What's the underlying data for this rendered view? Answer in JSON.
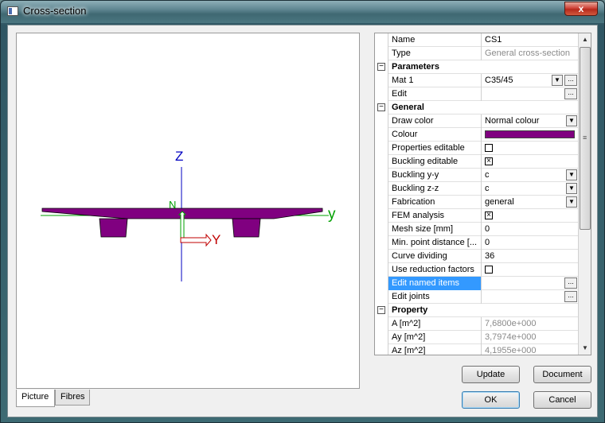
{
  "window": {
    "title": "Cross-section",
    "close_label": "x"
  },
  "picture": {
    "axis_z_label": "Z",
    "axis_y_label": "y",
    "local_y_label": "Y",
    "local_n_label": "N",
    "section_color": "#800080"
  },
  "tabs": [
    {
      "label": "Picture",
      "active": true
    },
    {
      "label": "Fibres",
      "active": false
    }
  ],
  "grid": {
    "rows": [
      {
        "kind": "prop",
        "name": "Name",
        "value": "CS1"
      },
      {
        "kind": "prop",
        "name": "Type",
        "value": "General cross-section",
        "gray": true
      },
      {
        "kind": "section",
        "name": "Parameters"
      },
      {
        "kind": "prop",
        "name": "Mat 1",
        "value": "C35/45",
        "combo": true,
        "ellipsis": true
      },
      {
        "kind": "prop",
        "name": "Edit",
        "value": "",
        "ellipsis": true
      },
      {
        "kind": "section",
        "name": "General"
      },
      {
        "kind": "prop",
        "name": "Draw color",
        "value": "Normal colour",
        "combo": true
      },
      {
        "kind": "prop",
        "name": "Colour",
        "swatch": "#800080"
      },
      {
        "kind": "prop",
        "name": "Properties editable",
        "checkbox": false
      },
      {
        "kind": "prop",
        "name": "Buckling editable",
        "checkbox": true
      },
      {
        "kind": "prop",
        "name": "Buckling y-y",
        "value": "c",
        "combo": true
      },
      {
        "kind": "prop",
        "name": "Buckling z-z",
        "value": "c",
        "combo": true
      },
      {
        "kind": "prop",
        "name": "Fabrication",
        "value": "general",
        "combo": true
      },
      {
        "kind": "prop",
        "name": "FEM analysis",
        "checkbox": true
      },
      {
        "kind": "prop",
        "name": "Mesh size [mm]",
        "value": "0"
      },
      {
        "kind": "prop",
        "name": "Min. point distance [...",
        "value": "0"
      },
      {
        "kind": "prop",
        "name": "Curve dividing",
        "value": "36"
      },
      {
        "kind": "prop",
        "name": "Use reduction factors",
        "checkbox": false
      },
      {
        "kind": "prop",
        "name": "Edit named items",
        "value": "",
        "ellipsis": true,
        "selected": true
      },
      {
        "kind": "prop",
        "name": "Edit joints",
        "value": "",
        "ellipsis": true
      },
      {
        "kind": "section",
        "name": "Property"
      },
      {
        "kind": "prop",
        "name": "A [m^2]",
        "value": "7,6800e+000",
        "gray": true
      },
      {
        "kind": "prop",
        "name": "Ay [m^2]",
        "value": "3,7974e+000",
        "gray": true
      },
      {
        "kind": "prop",
        "name": "Az [m^2]",
        "value": "4,1955e+000",
        "gray": true
      }
    ]
  },
  "buttons": {
    "update": "Update",
    "document": "Document",
    "ok": "OK",
    "cancel": "Cancel"
  }
}
